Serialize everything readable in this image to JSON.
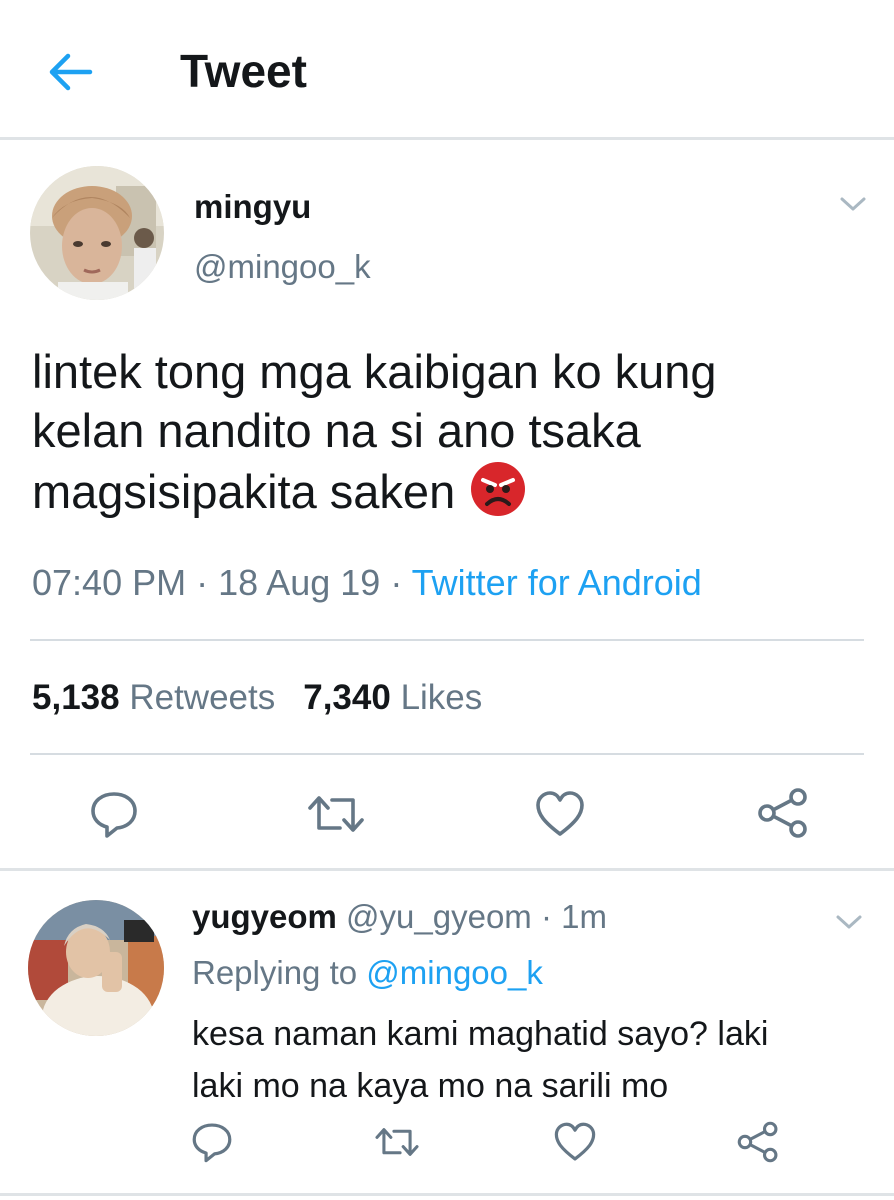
{
  "header": {
    "title": "Tweet",
    "back_icon": "arrow-left-icon"
  },
  "tweet": {
    "name": "mingyu",
    "handle": "@mingoo_k",
    "text_lines": [
      "lintek tong mga kaibigan ko kung",
      "kelan nandito na si ano tsaka",
      "magsisipakita saken"
    ],
    "emoji": "angry-face-emoji",
    "time": "07:40 PM",
    "separator": "·",
    "date": "18 Aug 19",
    "source": "Twitter for Android",
    "retweets_count": "5,138",
    "retweets_label": "Retweets",
    "likes_count": "7,340",
    "likes_label": "Likes"
  },
  "reply": {
    "name": "yugyeom",
    "handle": "@yu_gyeom",
    "age": "1m",
    "replying_label": "Replying to",
    "replying_to": "@mingoo_k",
    "text_lines": [
      "kesa naman kami maghatid sayo? laki",
      "laki mo na kaya mo na sarili mo"
    ]
  },
  "colors": {
    "accent": "#1da1f2",
    "secondary_text": "#657786",
    "primary_text": "#14171a",
    "divider": "#d6dce1"
  }
}
